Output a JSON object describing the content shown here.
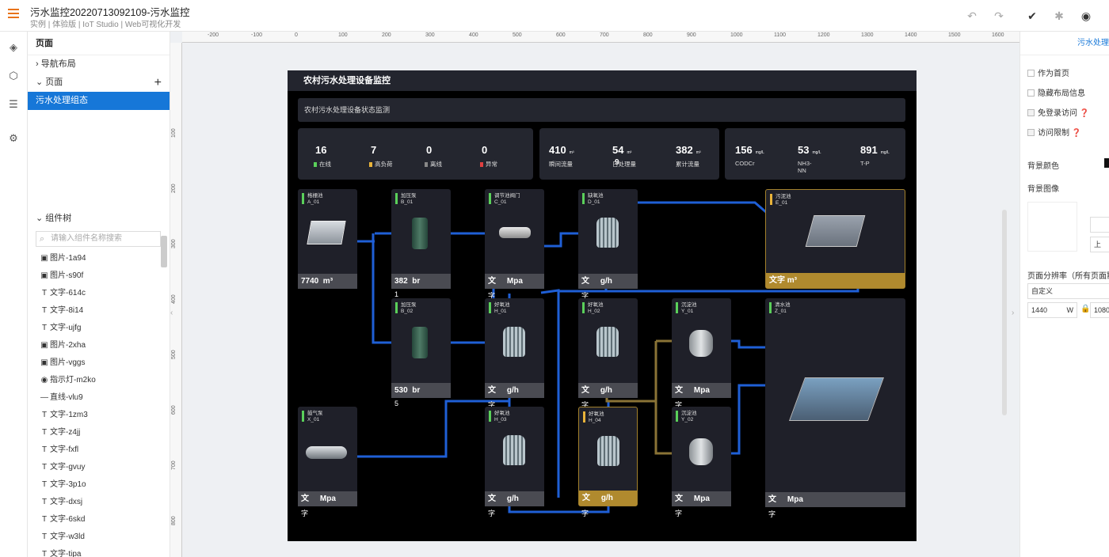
{
  "topbar": {
    "title": "污水监控20220713092109-污水监控",
    "subtitle": "实例 | 体验版 | IoT Studio | Web可视化开发"
  },
  "left": {
    "pages_header": "页面",
    "nav_layout": "导航布局",
    "pages_node": "页面",
    "selected_page": "污水处理组态",
    "tree_header": "组件树",
    "search_placeholder": "请输入组件名称搜索",
    "components": [
      {
        "icon": "img",
        "label": "图片-1a94"
      },
      {
        "icon": "img",
        "label": "图片-s90f"
      },
      {
        "icon": "text",
        "label": "文字-614c"
      },
      {
        "icon": "text",
        "label": "文字-8i14"
      },
      {
        "icon": "text",
        "label": "文字-ujfg"
      },
      {
        "icon": "img",
        "label": "图片-2xha"
      },
      {
        "icon": "img",
        "label": "图片-vggs"
      },
      {
        "icon": "lamp",
        "label": "指示灯-m2ko"
      },
      {
        "icon": "line",
        "label": "直线-vlu9"
      },
      {
        "icon": "text",
        "label": "文字-1zm3"
      },
      {
        "icon": "text",
        "label": "文字-z4jj"
      },
      {
        "icon": "text",
        "label": "文字-fxfl"
      },
      {
        "icon": "text",
        "label": "文字-gvuy"
      },
      {
        "icon": "text",
        "label": "文字-3p1o"
      },
      {
        "icon": "text",
        "label": "文字-dxsj"
      },
      {
        "icon": "text",
        "label": "文字-6skd"
      },
      {
        "icon": "text",
        "label": "文字-w3ld"
      },
      {
        "icon": "text",
        "label": "文字-tipa"
      }
    ]
  },
  "ruler": {
    "h": [
      "-200",
      "-100",
      "0",
      "100",
      "200",
      "300",
      "400",
      "500",
      "600",
      "700",
      "800",
      "900",
      "1000",
      "1100",
      "1200",
      "1300",
      "1400",
      "1500",
      "1600"
    ],
    "v": [
      "100",
      "200",
      "300",
      "400",
      "500",
      "600",
      "700",
      "800"
    ]
  },
  "board": {
    "title": "农村污水处理设备监控",
    "section": "农村污水处理设备状态监测",
    "stats1": [
      {
        "v": "16",
        "l": "在线",
        "c": "#5ad05a"
      },
      {
        "v": "7",
        "l": "高负荷",
        "c": "#e8b33a"
      },
      {
        "v": "0",
        "l": "离线",
        "c": "#888888"
      },
      {
        "v": "0",
        "l": "异常",
        "c": "#e04040"
      }
    ],
    "stats2": [
      {
        "v": "410",
        "u": "m³",
        "l": "瞬间流量"
      },
      {
        "v": "54",
        "u": "m³",
        "l": "日处理量"
      },
      {
        "v": "382",
        "u": "m³",
        "l": "累计流量"
      }
    ],
    "stats2_extra": "9",
    "stats3": [
      {
        "v": "156",
        "u": "mg/L",
        "l": "CODCr"
      },
      {
        "v": "53",
        "u": "mg/L",
        "l": "NH3-\nNN"
      },
      {
        "v": "891",
        "u": "mg/L",
        "l": "T-P"
      }
    ],
    "cards": {
      "A": {
        "name": "格栅池",
        "id": "A_01",
        "foot": "7740  m³"
      },
      "B1": {
        "name": "加压泵",
        "id": "B_01",
        "foot": "382  br",
        "under": "1"
      },
      "C": {
        "name": "调节池阀门",
        "id": "C_01",
        "foot": "文     Mpa",
        "under": "字"
      },
      "D": {
        "name": "缺氧池",
        "id": "D_01",
        "foot": "文     g/h",
        "under": "字"
      },
      "E": {
        "name": "污泥池",
        "id": "E_01",
        "foot": "文字 m³"
      },
      "B2": {
        "name": "加压泵",
        "id": "B_02",
        "foot": "530  br",
        "under": "5"
      },
      "H1": {
        "name": "好氧池",
        "id": "H_01",
        "foot": "文     g/h",
        "under": "字"
      },
      "H2": {
        "name": "好氧池",
        "id": "H_02",
        "foot": "文     g/h",
        "under": "字"
      },
      "Y1": {
        "name": "沉淀池",
        "id": "Y_01",
        "foot": "文     Mpa",
        "under": "字"
      },
      "Z": {
        "name": "清水池",
        "id": "Z_01",
        "foot": "文     Mpa",
        "under": "字"
      },
      "X": {
        "name": "鼓气泵",
        "id": "X_01",
        "foot": "文     Mpa",
        "under": "字"
      },
      "H3": {
        "name": "好氧池",
        "id": "H_03",
        "foot": "文     g/h",
        "under": "字"
      },
      "H4": {
        "name": "好氧池",
        "id": "H_04",
        "foot": "文     g/h",
        "under": "字"
      },
      "Y2": {
        "name": "沉淀池",
        "id": "Y_02",
        "foot": "文     Mpa",
        "under": "字"
      }
    }
  },
  "right": {
    "tab": "污水处理组",
    "home": "作为首页",
    "hide_layout": "隐藏布局信息",
    "free_login": "免登录访问",
    "access": "访问限制",
    "bg_color": "背景颜色",
    "bg_image": "背景图像",
    "resolution": "页面分辨率（所有页面默",
    "custom": "自定义",
    "width": "1440",
    "w": "W",
    "height": "1080",
    "upload": "上"
  }
}
